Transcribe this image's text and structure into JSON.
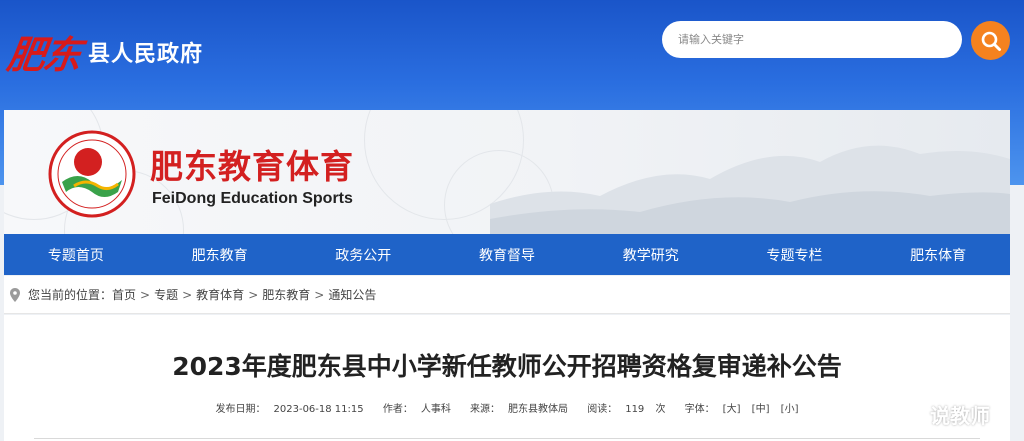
{
  "gov": {
    "logo_text": "肥东",
    "title": "县人民政府"
  },
  "search": {
    "placeholder": "请输入关键字",
    "icon": "search-icon"
  },
  "banner": {
    "title": "肥东教育体育",
    "subtitle": "FeiDong Education Sports",
    "emblem_ring_text": "FEIDONGJIAOYU"
  },
  "nav": {
    "items": [
      {
        "label": "专题首页"
      },
      {
        "label": "肥东教育"
      },
      {
        "label": "政务公开"
      },
      {
        "label": "教育督导"
      },
      {
        "label": "教学研究"
      },
      {
        "label": "专题专栏"
      },
      {
        "label": "肥东体育"
      }
    ]
  },
  "breadcrumb": {
    "prefix": "您当前的位置：",
    "items": [
      "首页",
      "专题",
      "教育体育",
      "肥东教育",
      "通知公告"
    ],
    "separator": ">"
  },
  "article": {
    "title": "2023年度肥东县中小学新任教师公开招聘资格复审递补公告",
    "meta": {
      "date_label": "发布日期：",
      "date": "2023-06-18 11:15",
      "author_label": "作者：",
      "author": "人事科",
      "source_label": "来源：",
      "source": "肥东县教体局",
      "reads_label": "阅读：",
      "reads": "119",
      "reads_unit": "次",
      "font_label": "字体：",
      "font_large": "[大]",
      "font_medium": "[中]",
      "font_small": "[小]"
    }
  },
  "watermark": {
    "text": "说教师"
  },
  "colors": {
    "header_blue": "#2a6ee0",
    "nav_blue": "#1f63c8",
    "brand_red": "#d32020",
    "search_orange": "#f5821f"
  }
}
